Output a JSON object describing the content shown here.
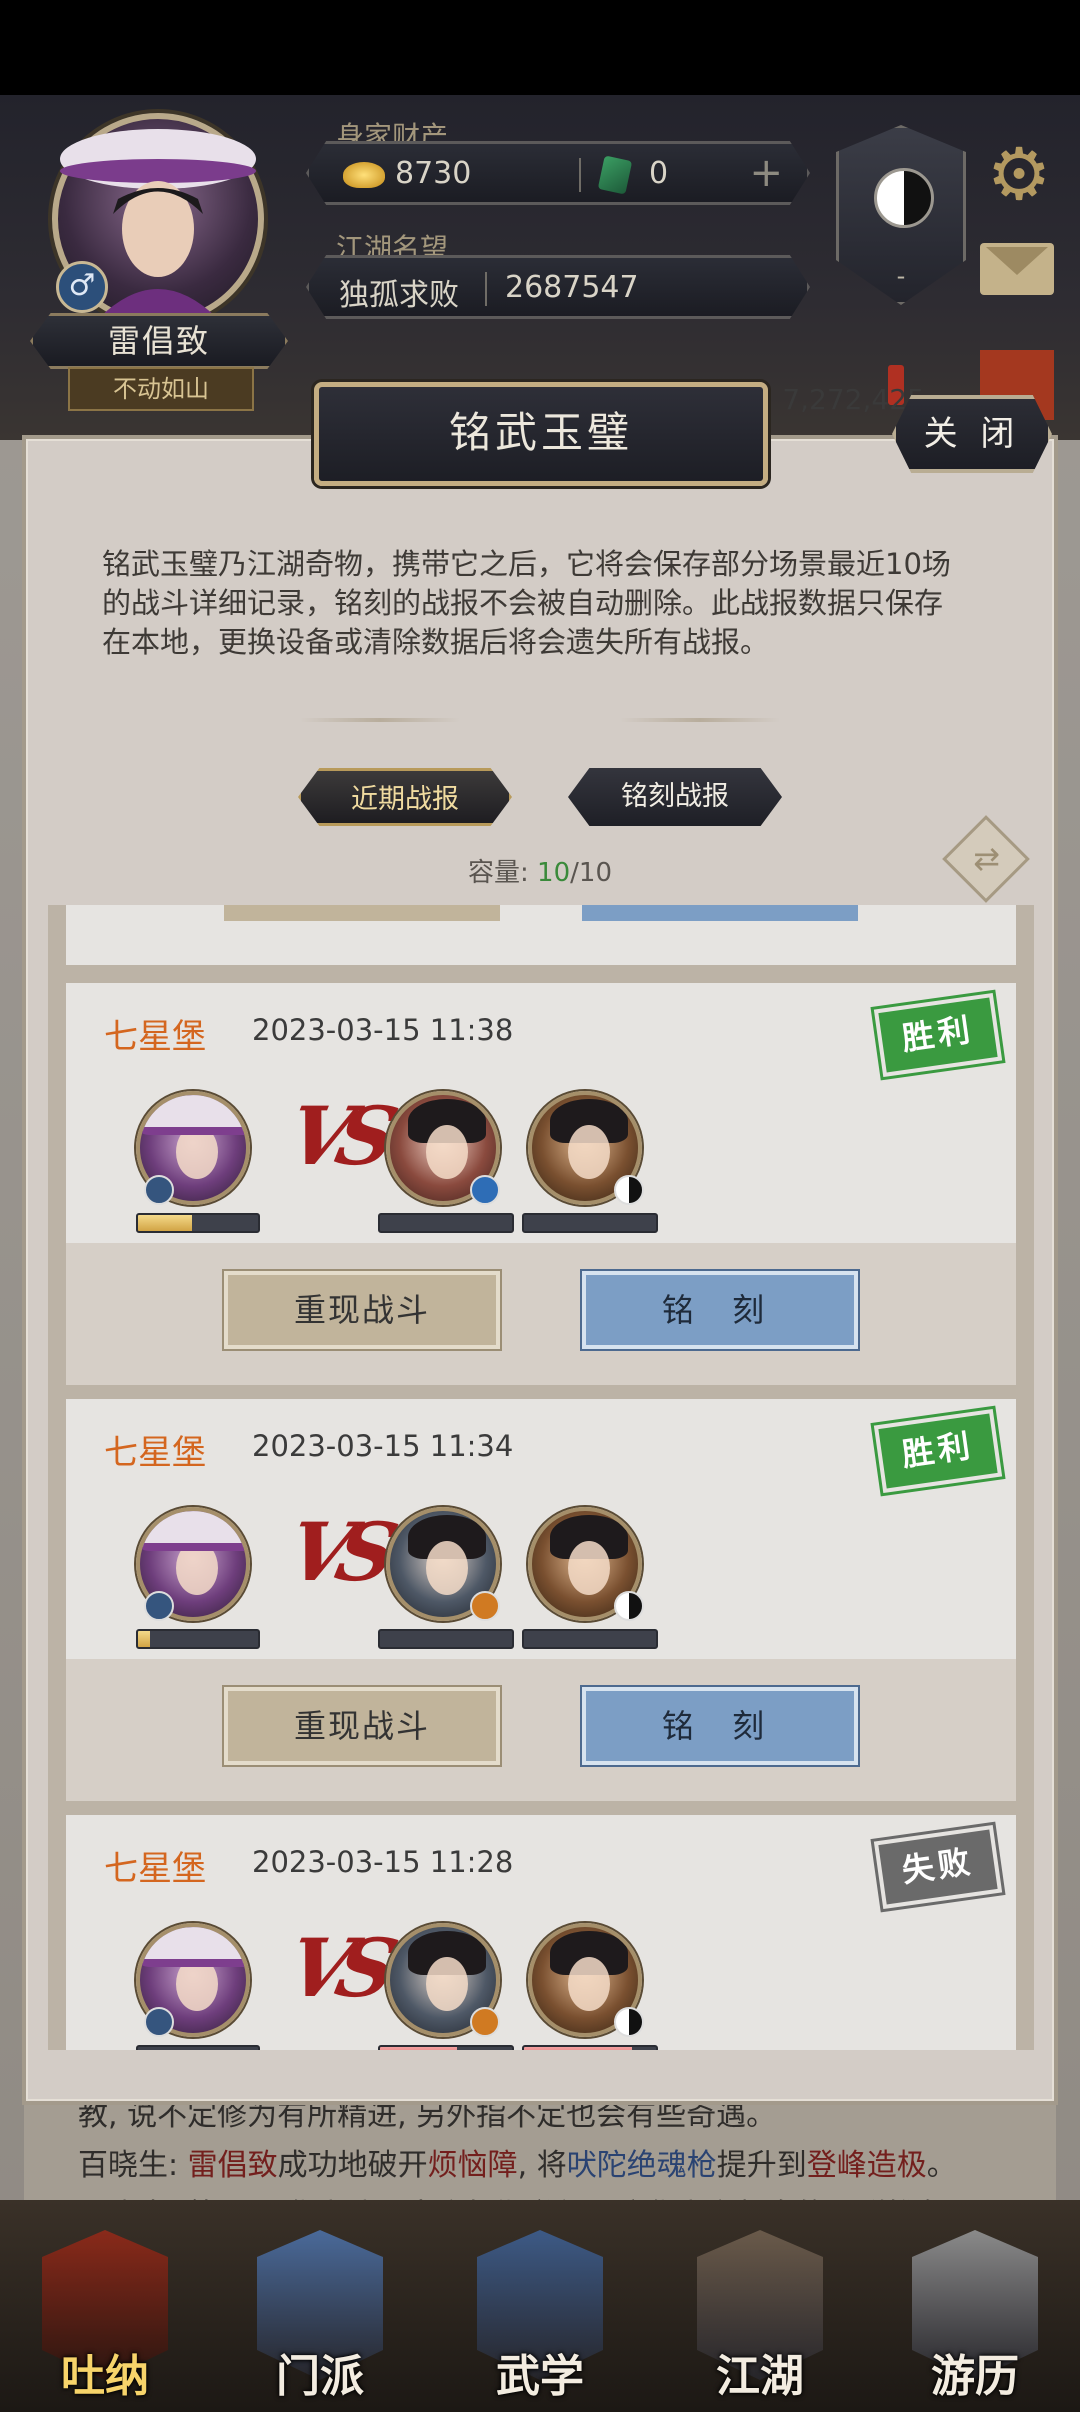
{
  "hud": {
    "player_name": "雷倡致",
    "player_title": "不动如山",
    "wealth_label": "身家财产",
    "gold_amount": "8730",
    "jade_amount": "0",
    "fame_label": "江湖名望",
    "fame_title": "独孤求败",
    "fame_value": "2687547",
    "stat_partial": "性: 7,272,425",
    "badge_mark": "-"
  },
  "modal": {
    "title": "铭武玉璧",
    "close_label": "关 闭",
    "description": "铭武玉璧乃江湖奇物，携带它之后，它将会保存部分场景最近10场的战斗详细记录，铭刻的战报不会被自动删除。此战报数据只保存在本地，更换设备或清除数据后将会遗失所有战报。",
    "tabs": [
      {
        "label": "近期战报"
      },
      {
        "label": "铭刻战报"
      }
    ],
    "capacity_label": "容量:",
    "capacity_used": "10",
    "capacity_total": "/10"
  },
  "battles": [
    {
      "location": "七星堡",
      "time": "2023-03-15 11:38",
      "result": "胜利",
      "vs": "VS",
      "self_hp": 0.45,
      "replay_label": "重现战斗",
      "engrave_label": "铭 刻"
    },
    {
      "location": "七星堡",
      "time": "2023-03-15 11:34",
      "result": "胜利",
      "vs": "VS",
      "self_hp": 0.1,
      "replay_label": "重现战斗",
      "engrave_label": "铭 刻"
    },
    {
      "location": "七星堡",
      "time": "2023-03-15 11:28",
      "result": "失败",
      "vs": "VS",
      "self_hp": 0.0,
      "replay_label": "重现战斗",
      "engrave_label": "铭 刻"
    }
  ],
  "log": {
    "line1": "教, 说不定修为有所精进, 另外指不定也会有些奇遇。",
    "line2_prefix": "百晓生: ",
    "line2_name": "雷倡致",
    "line2_mid1": "成功地破开",
    "line2_item1": "烦恼障",
    "line2_mid2": ", 将",
    "line2_skill": "吠陀绝魂枪",
    "line2_mid3": "提升到",
    "line2_level": "登峰造极",
    "line2_end": "。",
    "line3": "百晓生: 第21届华山武评大会如期举行，这华山之颠真的是群雄备需"
  },
  "nav": {
    "items": [
      {
        "label": "吐纳"
      },
      {
        "label": "门派"
      },
      {
        "label": "武学"
      },
      {
        "label": "江湖"
      },
      {
        "label": "游历"
      }
    ]
  },
  "colors": {
    "accent_win": "#3a9a40",
    "accent_lose": "#6a6a6a",
    "location_orange": "#d4661f",
    "engrave_blue": "#7c9ec5"
  }
}
